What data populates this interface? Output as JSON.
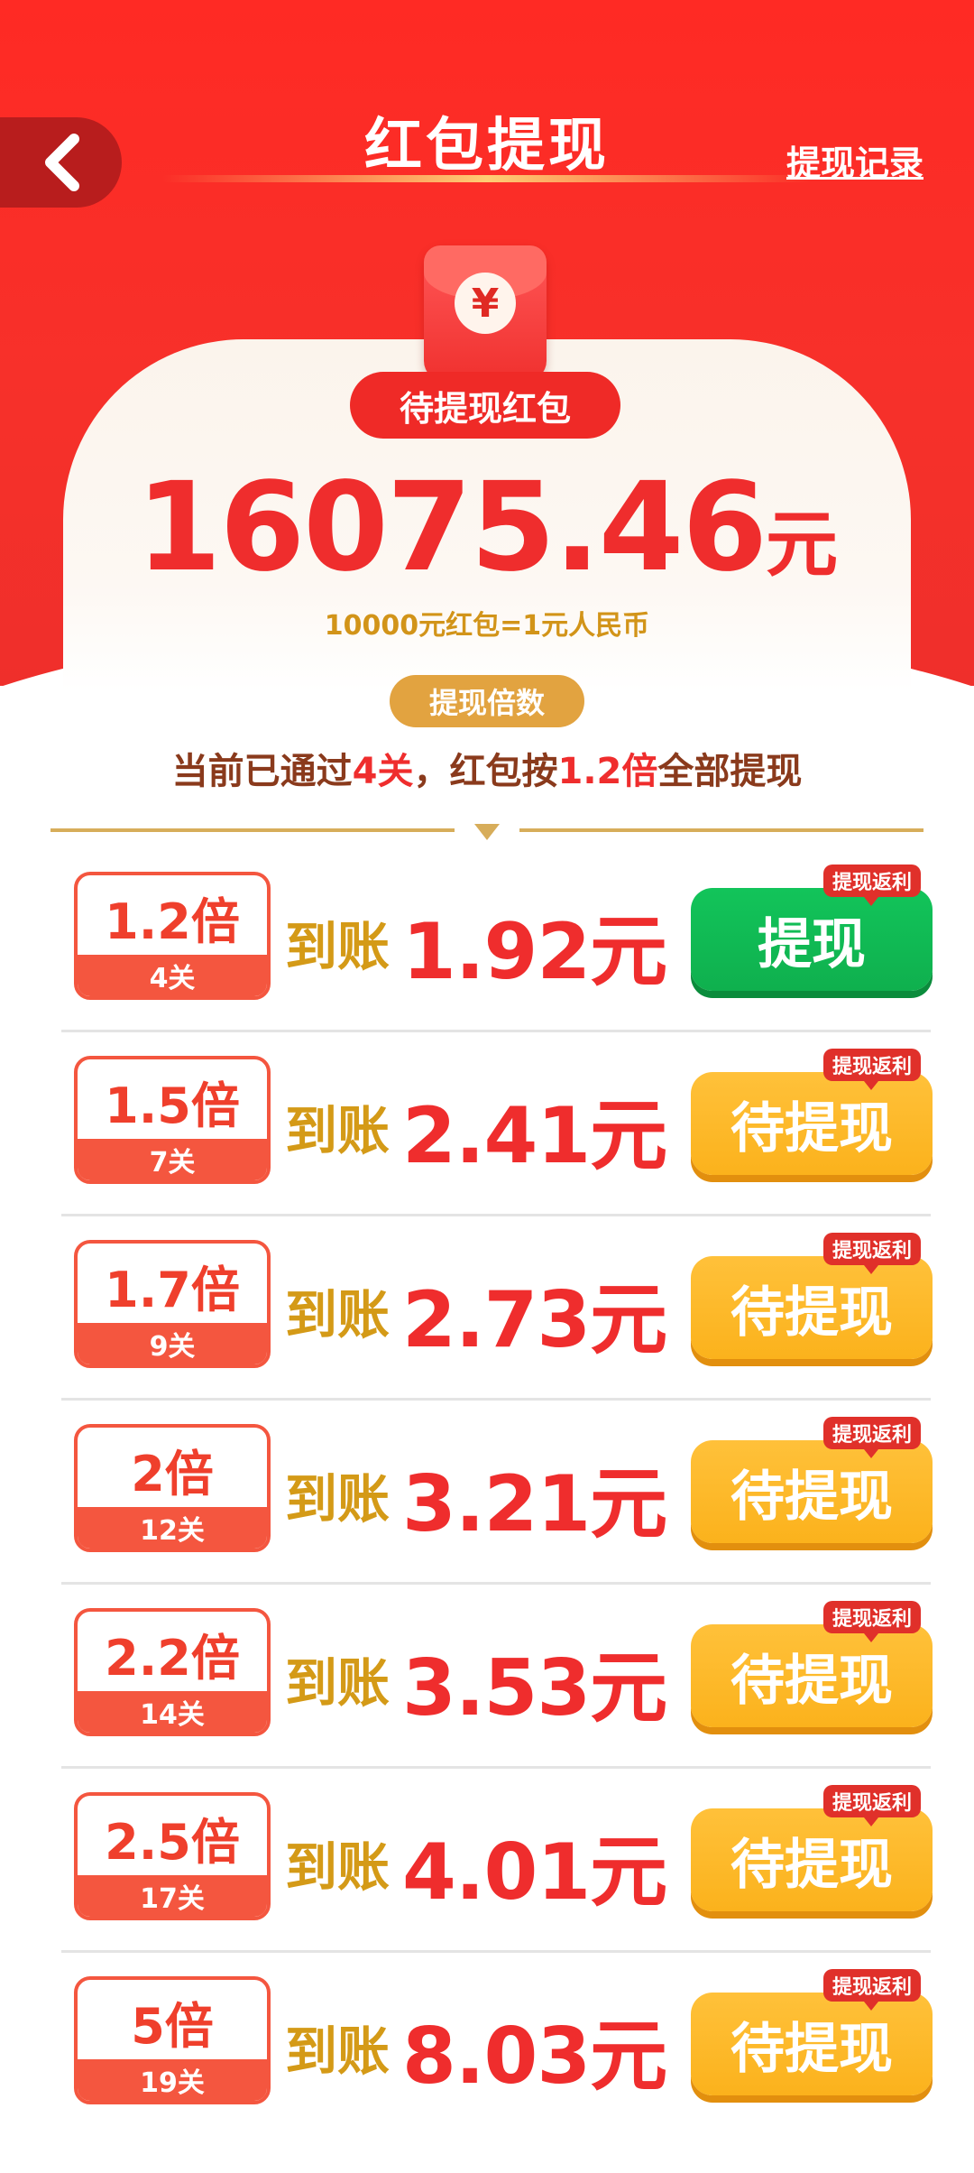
{
  "header": {
    "title": "红包提现",
    "record_link": "提现记录",
    "back_icon": "chevron-left-icon"
  },
  "balance": {
    "label": "待提现红包",
    "amount": "16075.46",
    "unit": "元",
    "rate_note": "10000元红包=1元人民币",
    "envelope_symbol": "¥"
  },
  "multiplier": {
    "section_label": "提现倍数",
    "status_prefix": "当前已通过",
    "status_levels": "4关",
    "status_middle": "，红包按",
    "status_multiplier": "1.2倍",
    "status_suffix": "全部提现"
  },
  "colors": {
    "brand_red": "#ef2d2d",
    "gold": "#d49a17",
    "active_green": "#12c45a",
    "pending_orange": "#fbb21c"
  },
  "tiers": [
    {
      "multiplier": "1.2倍",
      "level": "4关",
      "arrive": "到账",
      "amount": "1.92元",
      "action": "提现",
      "state": "active",
      "tag": "提现返利"
    },
    {
      "multiplier": "1.5倍",
      "level": "7关",
      "arrive": "到账",
      "amount": "2.41元",
      "action": "待提现",
      "state": "pending",
      "tag": "提现返利"
    },
    {
      "multiplier": "1.7倍",
      "level": "9关",
      "arrive": "到账",
      "amount": "2.73元",
      "action": "待提现",
      "state": "pending",
      "tag": "提现返利"
    },
    {
      "multiplier": "2倍",
      "level": "12关",
      "arrive": "到账",
      "amount": "3.21元",
      "action": "待提现",
      "state": "pending",
      "tag": "提现返利"
    },
    {
      "multiplier": "2.2倍",
      "level": "14关",
      "arrive": "到账",
      "amount": "3.53元",
      "action": "待提现",
      "state": "pending",
      "tag": "提现返利"
    },
    {
      "multiplier": "2.5倍",
      "level": "17关",
      "arrive": "到账",
      "amount": "4.01元",
      "action": "待提现",
      "state": "pending",
      "tag": "提现返利"
    },
    {
      "multiplier": "5倍",
      "level": "19关",
      "arrive": "到账",
      "amount": "8.03元",
      "action": "待提现",
      "state": "pending",
      "tag": "提现返利"
    }
  ]
}
